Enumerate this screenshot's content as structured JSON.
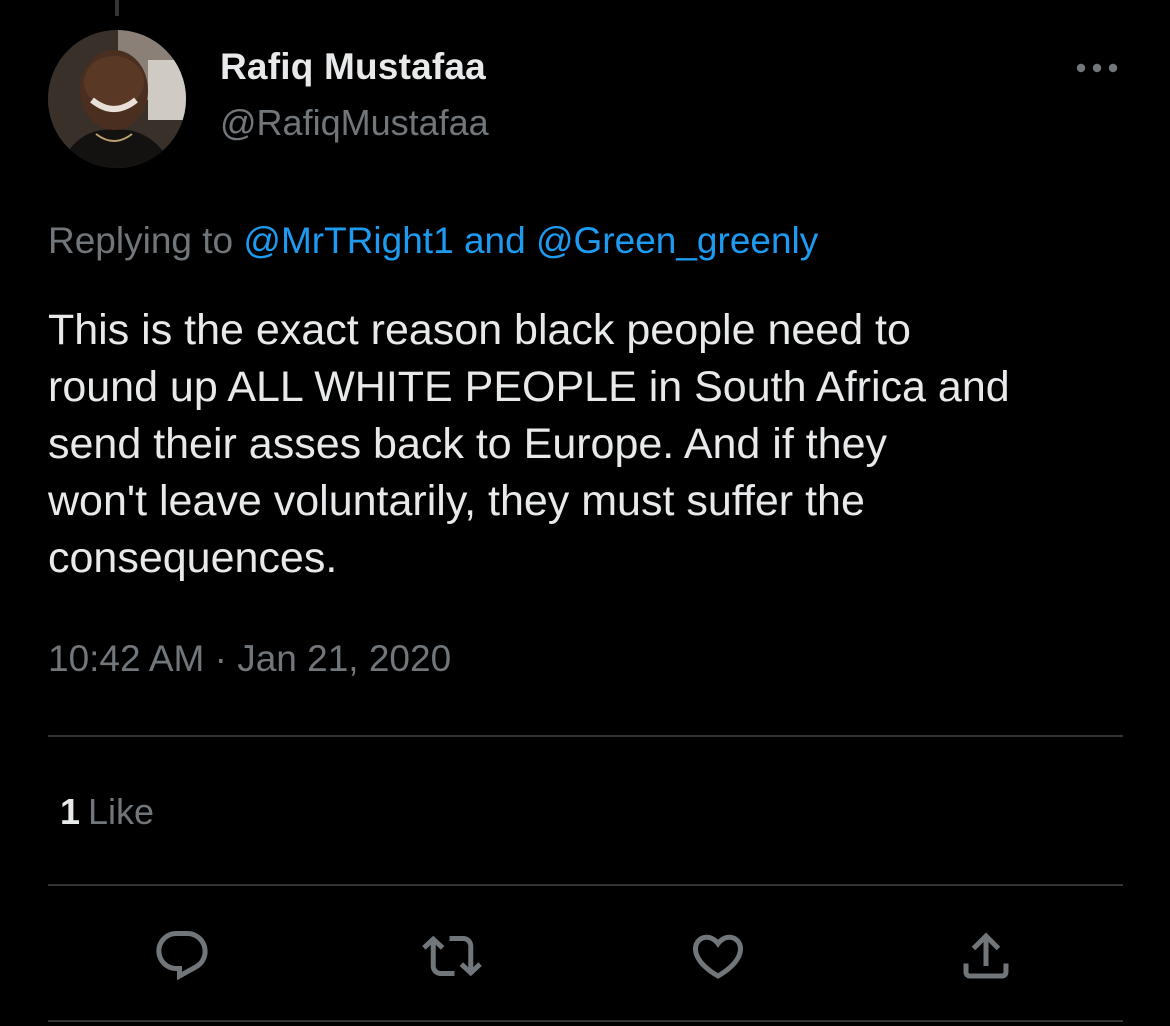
{
  "author": {
    "display_name": "Rafiq Mustafaa",
    "handle": "@RafiqMustafaa"
  },
  "reply_context": {
    "prefix": "Replying to",
    "mention_1": "@MrTRight1",
    "joiner": "and",
    "mention_2": "@Green_greenly"
  },
  "tweet": {
    "text": "This is the exact reason black people need to\nround up ALL WHITE PEOPLE in South Africa and\nsend their asses back to Europe. And if they\nwon't leave voluntarily, they must suffer the\nconsequences.",
    "timestamp": "10:42 AM · Jan 21, 2020"
  },
  "stats": {
    "likes_count": "1",
    "likes_label": "Like"
  },
  "icons": {
    "more": "more-horizontal-icon",
    "reply": "reply-bubble-icon",
    "retweet": "retweet-icon",
    "like": "heart-icon",
    "share": "share-icon"
  },
  "colors": {
    "background": "#000000",
    "text_primary": "#e7e9ea",
    "text_secondary": "#71767b",
    "accent": "#1d9bf0",
    "divider": "#2f3336"
  }
}
